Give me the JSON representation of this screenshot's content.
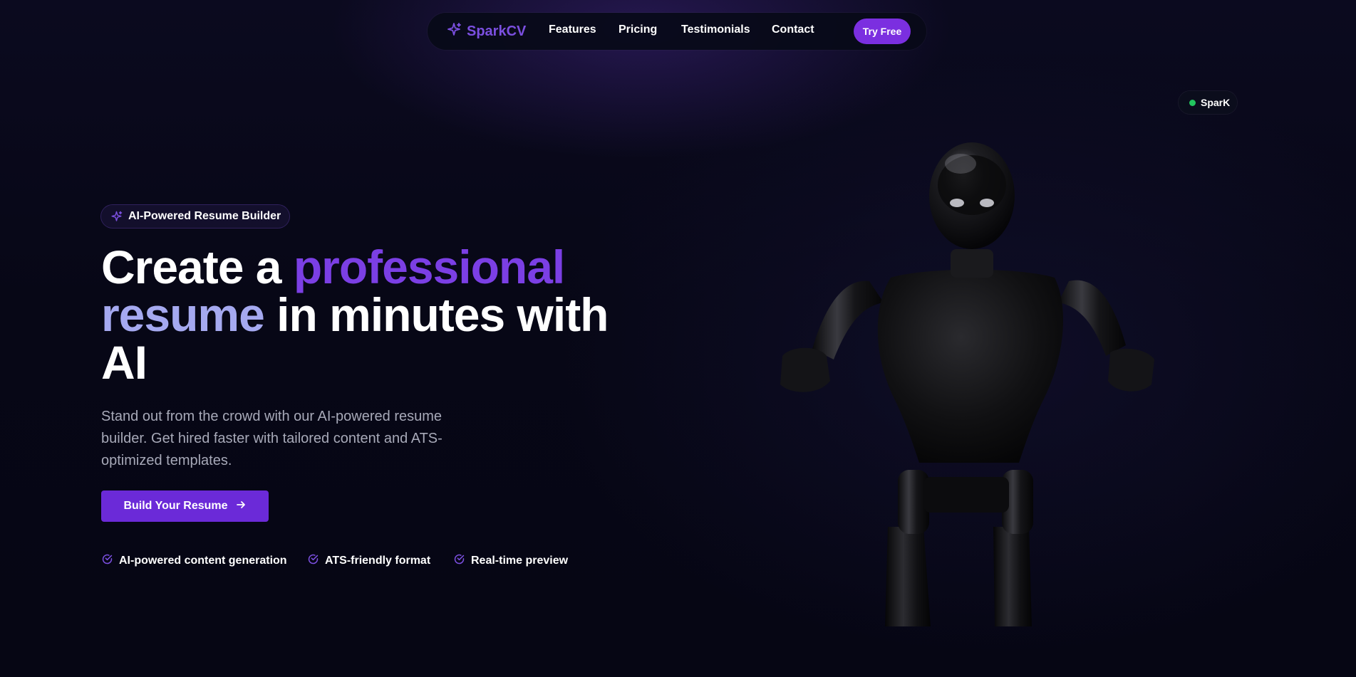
{
  "nav": {
    "brand": "SparkCV",
    "links": [
      "Features",
      "Pricing",
      "Testimonials",
      "Contact"
    ],
    "cta": "Try Free"
  },
  "status": {
    "label": "SparK"
  },
  "hero": {
    "badge": "AI-Powered Resume Builder",
    "headline": {
      "part1": "Create a ",
      "highlight1": "professional",
      "highlight2": "resume",
      "part2": " in minutes with AI"
    },
    "subtext": "Stand out from the crowd with our AI-powered resume builder. Get hired faster with tailored content and ATS-optimized templates.",
    "cta": "Build Your Resume",
    "features": [
      "AI-powered content generation",
      "ATS-friendly format",
      "Real-time preview"
    ]
  },
  "colors": {
    "accent": "#7b2fe0",
    "accent_text": "#7b3fe4",
    "highlight_lavender": "#a5a9f0",
    "background": "#070716",
    "status_green": "#22c55e"
  },
  "icons": {
    "brand": "sparkle-icon",
    "badge": "sparkle-icon",
    "cta": "arrow-right-icon",
    "feature": "check-circle-icon",
    "status": "status-dot-icon"
  }
}
